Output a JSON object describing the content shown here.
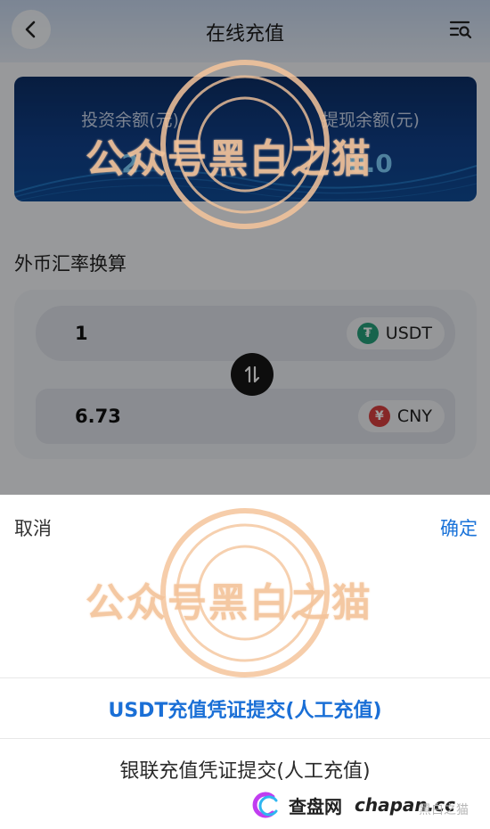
{
  "header": {
    "title": "在线充值",
    "back_icon": "chevron-left-icon",
    "menu_icon": "list-search-icon"
  },
  "balance": {
    "invest_label": "投资余额(元)",
    "invest_value": "2",
    "withdraw_label": "提现余额(元)",
    "withdraw_value": "0.0"
  },
  "exchange": {
    "section_title": "外币汇率换算",
    "from_value": "1",
    "from_currency": "USDT",
    "from_icon": "tether-icon",
    "to_value": "6.73",
    "to_currency": "CNY",
    "to_icon": "yuan-icon",
    "swap_icon": "swap-vertical-icon"
  },
  "sheet": {
    "cancel_label": "取消",
    "confirm_label": "确定",
    "options": [
      "USDT充值凭证提交(人工充值)",
      "银联充值凭证提交(人工充值)"
    ]
  },
  "watermark": {
    "text": "公众号黑白之猫",
    "footer_brand": "查盘网",
    "footer_domain": "chapan.cc",
    "footer_faded": "黑白之猫"
  },
  "colors": {
    "accent": "#1a73d9",
    "card_dark": "#0c2f66",
    "watermark": "#f4c49b",
    "usdt_green": "#26a17b",
    "cny_red": "#d8403f"
  }
}
